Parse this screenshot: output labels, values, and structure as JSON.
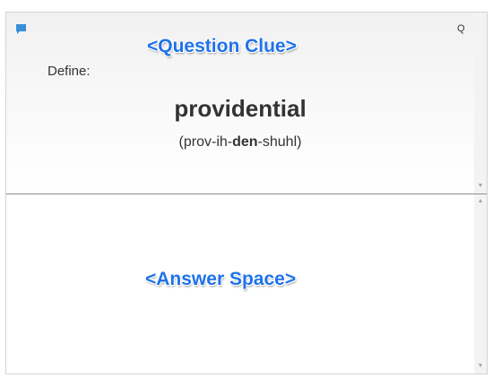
{
  "icons": {
    "comment": "comment-icon",
    "scroll_up": "scroll-up-arrow-icon",
    "scroll_down": "scroll-down-arrow-icon"
  },
  "colors": {
    "comment_icon": "#3a8fd8",
    "overlay_label": "#1f72e8",
    "text": "#333333"
  },
  "question": {
    "shortcut_key": "Q",
    "overlay_label": "<Question Clue>",
    "define_label": "Define:",
    "word": "providential",
    "pronunciation": {
      "open_paren": "(",
      "pre": "prov-ih-",
      "stressed": "den",
      "post": "-shuhl",
      "close_paren": ")"
    }
  },
  "answer": {
    "overlay_label": "<Answer Space>"
  }
}
